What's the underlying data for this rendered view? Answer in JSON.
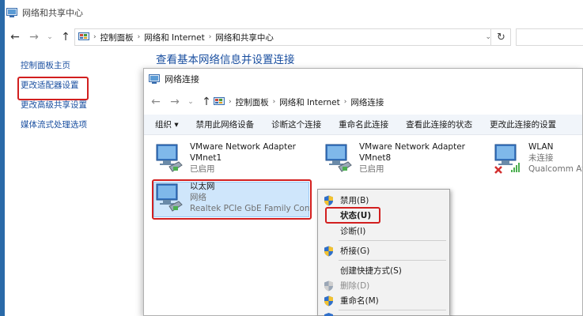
{
  "outer_window": {
    "title": "网络和共享中心",
    "breadcrumbs": [
      "控制面板",
      "网络和 Internet",
      "网络和共享中心"
    ],
    "sidebar_links": [
      "控制面板主页",
      "更改适配器设置",
      "更改高级共享设置",
      "媒体流式处理选项"
    ],
    "heading": "查看基本网络信息并设置连接"
  },
  "inner_window": {
    "title": "网络连接",
    "breadcrumbs": [
      "控制面板",
      "网络和 Internet",
      "网络连接"
    ],
    "toolbar": [
      "组织 ▾",
      "禁用此网络设备",
      "诊断这个连接",
      "重命名此连接",
      "查看此连接的状态",
      "更改此连接的设置"
    ],
    "adapters": [
      {
        "name": "VMware Network Adapter",
        "line2": "VMnet1",
        "status": "已启用"
      },
      {
        "name": "VMware Network Adapter",
        "line2": "VMnet8",
        "status": "已启用"
      },
      {
        "name": "WLAN",
        "line2": "未连接",
        "status": "Qualcomm At"
      },
      {
        "name": "以太网",
        "line2": "网络",
        "status": "Realtek PCIe GbE Family Contr..."
      }
    ]
  },
  "context_menu": {
    "items": [
      {
        "label": "禁用(B)",
        "shield": true,
        "disabled": false
      },
      {
        "label": "状态(U)",
        "shield": false,
        "disabled": false
      },
      {
        "label": "诊断(I)",
        "shield": false,
        "disabled": false
      },
      {
        "label": "桥接(G)",
        "shield": true,
        "disabled": false
      },
      {
        "label": "创建快捷方式(S)",
        "shield": false,
        "disabled": false
      },
      {
        "label": "删除(D)",
        "shield": true,
        "disabled": true
      },
      {
        "label": "重命名(M)",
        "shield": true,
        "disabled": false
      }
    ]
  },
  "colors": {
    "link": "#1a4fa0",
    "highlight_red": "#d21f1f",
    "selection": "#cfe6fb"
  }
}
